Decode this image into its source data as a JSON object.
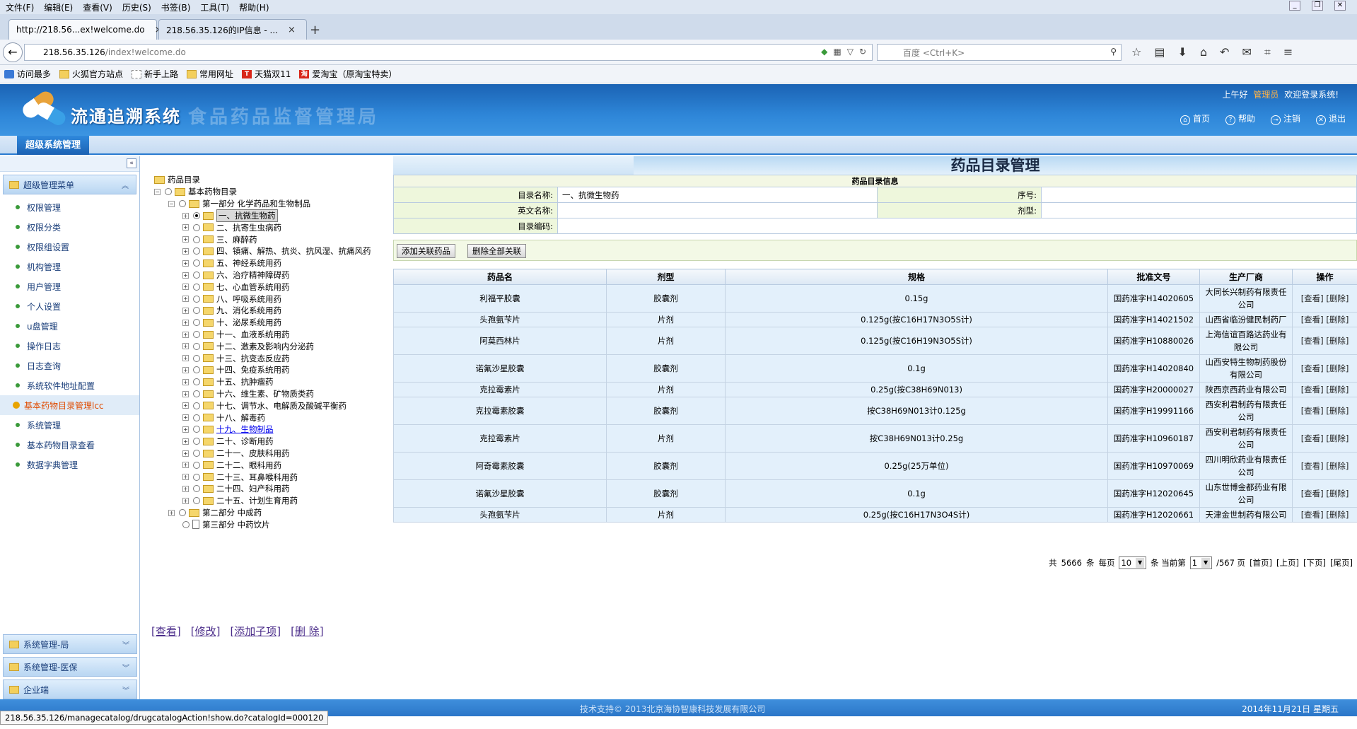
{
  "browser": {
    "menu": [
      "文件(F)",
      "编辑(E)",
      "查看(V)",
      "历史(S)",
      "书签(B)",
      "工具(T)",
      "帮助(H)"
    ],
    "tabs": [
      {
        "title": "http://218.56...ex!welcome.do"
      },
      {
        "title": "218.56.35.126的IP信息 - ..."
      }
    ],
    "url_host": "218.56.35.126",
    "url_path": "/index!welcome.do",
    "search_placeholder": "百度 <Ctrl+K>",
    "bookmarks": [
      "访问最多",
      "火狐官方站点",
      "新手上路",
      "常用网址",
      "天猫双11",
      "爱淘宝（原淘宝特卖）"
    ],
    "status_url": "218.56.35.126/managecatalog/drugcatalogAction!show.do?catalogId=000120"
  },
  "header": {
    "app_name": "流通追溯系统",
    "org_name": "食品药品监督管理局",
    "greeting_prefix": "上午好",
    "user": "管理员",
    "greeting_suffix": "欢迎登录系统!",
    "links": [
      "首页",
      "帮助",
      "注销",
      "退出"
    ],
    "module_tab": "超级系统管理"
  },
  "sidebar": {
    "section": "超级管理菜单",
    "items": [
      "权限管理",
      "权限分类",
      "权限组设置",
      "机构管理",
      "用户管理",
      "个人设置",
      "u盘管理",
      "操作日志",
      "日志查询",
      "系统软件地址配置",
      "基本药物目录管理lcc",
      "系统管理",
      "基本药物目录查看",
      "数据字典管理"
    ],
    "active_index": 10,
    "bottom_sections": [
      "系统管理-局",
      "系统管理-医保",
      "企业端"
    ]
  },
  "tree": {
    "root": "药品目录",
    "level1": "基本药物目录",
    "part1": "第一部分 化学药品和生物制品",
    "children": [
      "一、抗微生物药",
      "二、抗寄生虫病药",
      "三、麻醉药",
      "四、镇痛、解热、抗炎、抗风湿、抗痛风药",
      "五、神经系统用药",
      "六、治疗精神障碍药",
      "七、心血管系统用药",
      "八、呼吸系统用药",
      "九、消化系统用药",
      "十、泌尿系统用药",
      "十一、血液系统用药",
      "十二、激素及影响内分泌药",
      "十三、抗变态反应药",
      "十四、免疫系统用药",
      "十五、抗肿瘤药",
      "十六、维生素、矿物质类药",
      "十七、调节水、电解质及酸碱平衡药",
      "十八、解毒药",
      "十九、生物制品",
      "二十、诊断用药",
      "二十一、皮肤科用药",
      "二十二、眼科用药",
      "二十三、耳鼻喉科用药",
      "二十四、妇产科用药",
      "二十五、计划生育用药"
    ],
    "part2": "第二部分 中成药",
    "part3": "第三部分 中药饮片",
    "actions": [
      "[查看]",
      "[修改]",
      "[添加子项]",
      "[删 除]"
    ]
  },
  "main": {
    "title": "药品目录管理",
    "info_caption": "药品目录信息",
    "labels": {
      "name": "目录名称:",
      "seq": "序号:",
      "en_name": "英文名称:",
      "form": "剂型:",
      "code": "目录编码:"
    },
    "values": {
      "name": "一、抗微生物药",
      "seq": "",
      "en_name": "",
      "form": "",
      "code": ""
    },
    "buttons": [
      "添加关联药品",
      "删除全部关联"
    ],
    "columns": [
      "药品名",
      "剂型",
      "规格",
      "批准文号",
      "生产厂商",
      "操作"
    ],
    "rows": [
      [
        "利福平胶囊",
        "胶囊剂",
        "0.15g",
        "国药准字H14020605",
        "大同长兴制药有限责任公司"
      ],
      [
        "头孢氨苄片",
        "片剂",
        "0.125g(按C16H17N3O5S计)",
        "国药准字H14021502",
        "山西省临汾健民制药厂"
      ],
      [
        "阿莫西林片",
        "片剂",
        "0.125g(按C16H19N3O5S计)",
        "国药准字H10880026",
        "上海信谊百路达药业有限公司"
      ],
      [
        "诺氟沙星胶囊",
        "胶囊剂",
        "0.1g",
        "国药准字H14020840",
        "山西安特生物制药股份有限公司"
      ],
      [
        "克拉霉素片",
        "片剂",
        "0.25g(按C38H69N013)",
        "国药准字H20000027",
        "陕西京西药业有限公司"
      ],
      [
        "克拉霉素胶囊",
        "胶囊剂",
        "按C38H69N013计0.125g",
        "国药准字H19991166",
        "西安利君制药有限责任公司"
      ],
      [
        "克拉霉素片",
        "片剂",
        "按C38H69N013计0.25g",
        "国药准字H10960187",
        "西安利君制药有限责任公司"
      ],
      [
        "阿奇霉素胶囊",
        "胶囊剂",
        "0.25g(25万单位)",
        "国药准字H10970069",
        "四川明欣药业有限责任公司"
      ],
      [
        "诺氟沙星胶囊",
        "胶囊剂",
        "0.1g",
        "国药准字H12020645",
        "山东世博金都药业有限公司"
      ],
      [
        "头孢氨苄片",
        "片剂",
        "0.25g(按C16H17N3O4S计)",
        "国药准字H12020661",
        "天津金世制药有限公司"
      ]
    ],
    "op_view": "[查看]",
    "op_delete": "[删除]",
    "pager": {
      "total_prefix": "共",
      "total": "5666",
      "total_suffix": "条",
      "per_page_label": "每页",
      "per_page": "10",
      "current_label": "条 当前第",
      "current": "1",
      "pages": "/567 页",
      "links": [
        "[首页]",
        "[上页]",
        "[下页]",
        "[尾页]"
      ]
    }
  },
  "footer": {
    "support": "技术支持©  2013北京海协智康科技发展有限公司",
    "date": "2014年11月21日 星期五"
  }
}
